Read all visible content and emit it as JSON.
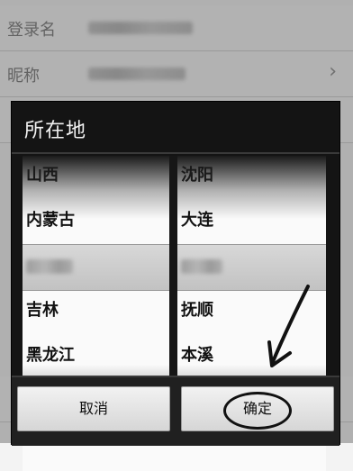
{
  "background": {
    "rows": [
      {
        "label": "登录名",
        "has_chevron": false
      },
      {
        "label": "昵称",
        "has_chevron": true
      }
    ],
    "chevron": "›"
  },
  "dialog": {
    "title": "所在地",
    "province_wheel": {
      "above": [
        "山西",
        "内蒙古"
      ],
      "below": [
        "吉林",
        "黑龙江"
      ]
    },
    "city_wheel": {
      "above": [
        "沈阳",
        "大连"
      ],
      "below": [
        "抚顺",
        "本溪"
      ]
    },
    "buttons": {
      "cancel": "取消",
      "confirm": "确定"
    }
  },
  "annotation": {
    "arrow_color": "#111111",
    "circle_target": "confirm-button"
  }
}
